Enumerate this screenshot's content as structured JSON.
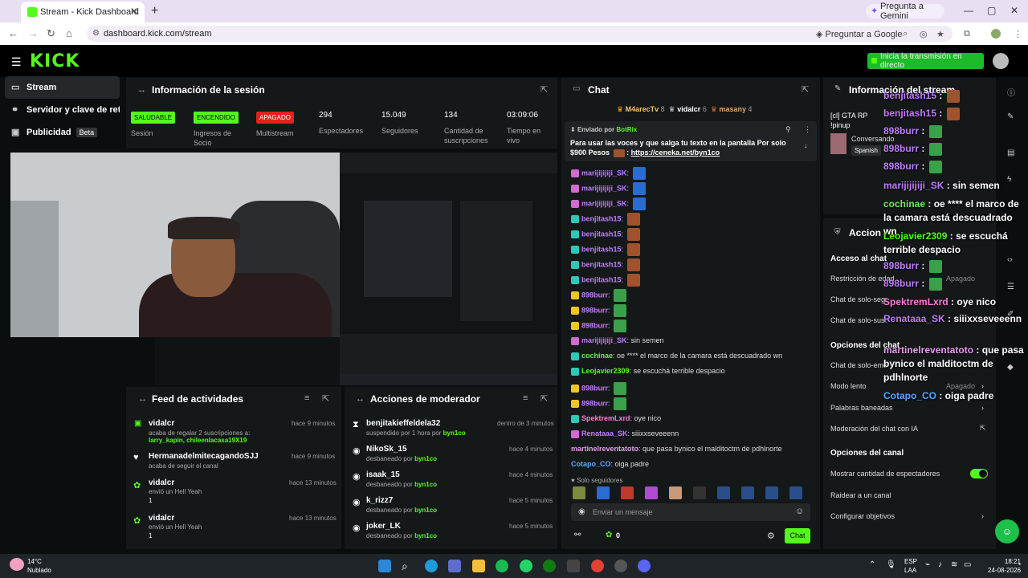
{
  "browser": {
    "tab_title": "Stream - Kick Dashboard",
    "url": "dashboard.kick.com/stream",
    "gemini_label": "Pregunta a Gemini",
    "google_label": "Preguntar a Google"
  },
  "kick": {
    "logo": "KICK",
    "go_live_label": "Inicia la transmisión en directo"
  },
  "sidebar": {
    "items": [
      {
        "label": "Stream"
      },
      {
        "label": "Servidor y clave de retran"
      },
      {
        "label": "Publicidad"
      }
    ],
    "beta": "Beta"
  },
  "session": {
    "title": "Información de la sesión",
    "stats": [
      {
        "badge": "SALUDABLE",
        "label": "Sesión",
        "color": "#53fc18"
      },
      {
        "badge": "ENCENDIDO",
        "label": "Ingresos de Socio",
        "color": "#53fc18"
      },
      {
        "badge": "APAGADO",
        "label": "Multistream",
        "color": "#e0231c"
      },
      {
        "value": "294",
        "label": "Espectadores"
      },
      {
        "value": "15.049",
        "label": "Seguidores"
      },
      {
        "value": "134",
        "label": "Cantidad de suscripciones"
      },
      {
        "value": "03:09:06",
        "label": "Tiempo en vivo"
      }
    ]
  },
  "feed": {
    "title": "Feed de actividades",
    "items": [
      {
        "name": "vidalcr",
        "time": "hace 9 minutos",
        "line1": "acaba de regalar 2 suscripciones a:",
        "line2": "larry_kapin, chileenlacasa19X19"
      },
      {
        "name": "HermanadelmitecagandoSJJ",
        "time": "hace 9 minutos",
        "line1": "acaba de seguir el canal",
        "line2": ""
      },
      {
        "name": "vidalcr",
        "time": "hace 13 minutos",
        "line1": "envió un Hell Yeah",
        "line2": "1"
      },
      {
        "name": "vidalcr",
        "time": "hace 13 minutos",
        "line1": "envió un Hell Yeah",
        "line2": "1"
      }
    ]
  },
  "modactions": {
    "title": "Acciones de moderador",
    "items": [
      {
        "name": "benjitakieffeldela32",
        "time": "dentro de 3 minutos",
        "desc": "suspendido por 1 hora por",
        "by": "byn1co"
      },
      {
        "name": "NikoSk_15",
        "time": "hace 4 minutos",
        "desc": "desbaneado por",
        "by": "byn1co"
      },
      {
        "name": "isaak_15",
        "time": "hace 4 minutos",
        "desc": "desbaneado por",
        "by": "byn1co"
      },
      {
        "name": "k_rizz7",
        "time": "hace 5 minutos",
        "desc": "desbaneado por",
        "by": "byn1co"
      },
      {
        "name": "joker_LK",
        "time": "hace 5 minutos",
        "desc": "desbaneado por",
        "by": "byn1co"
      }
    ]
  },
  "chat": {
    "title": "Chat",
    "top_gifters": [
      {
        "name": "M4arecTv",
        "count": "8"
      },
      {
        "name": "vidalcr",
        "count": "6"
      },
      {
        "name": "masany",
        "count": "4"
      }
    ],
    "pinned_by_label": "Enviado por",
    "pinned_by": "BotRix",
    "pinned_text": "Para usar las voces y que salga tu texto en la pantalla Por solo $900 Pesos",
    "pinned_link": "https://ceneka.net/byn1co",
    "messages": [
      {
        "user": "marijijijiji_SK",
        "text": "",
        "color": "#c07cff"
      },
      {
        "user": "marijijijiji_SK",
        "text": "",
        "color": "#c07cff"
      },
      {
        "user": "marijijijiji_SK",
        "text": "",
        "color": "#c07cff"
      },
      {
        "user": "benjitash15",
        "text": "",
        "color": "#c07cff"
      },
      {
        "user": "benjitash15",
        "text": "",
        "color": "#c07cff"
      },
      {
        "user": "benjitash15",
        "text": "",
        "color": "#c07cff"
      },
      {
        "user": "benjitash15",
        "text": "",
        "color": "#c07cff"
      },
      {
        "user": "benjitash15",
        "text": "",
        "color": "#c07cff"
      },
      {
        "user": "898burr",
        "text": "",
        "color": "#c07cff"
      },
      {
        "user": "898burr",
        "text": "",
        "color": "#c07cff"
      },
      {
        "user": "898burr",
        "text": "",
        "color": "#c07cff"
      },
      {
        "user": "marijijijiji_SK",
        "text": "sin semen",
        "color": "#c07cff"
      },
      {
        "user": "cochinae",
        "text": "oe **** el marco de la camara está descuadrado wn",
        "color": "#7be36a"
      },
      {
        "user": "Leojavier2309",
        "text": "se escuchá terrible despacio",
        "color": "#53fc18"
      },
      {
        "user": "898burr",
        "text": "",
        "color": "#c07cff"
      },
      {
        "user": "898burr",
        "text": "",
        "color": "#c07cff"
      },
      {
        "user": "SpektremLxrd",
        "text": "oye nico",
        "color": "#ff7ad9"
      },
      {
        "user": "Renataaa_SK",
        "text": "siiixxseveeenn",
        "color": "#c07cff"
      },
      {
        "user": "martinelreventatoto",
        "text": "que pasa bynico el malditoctm de pdhlnorte",
        "color": "#e89bf0"
      },
      {
        "user": "Cotapo_CO",
        "text": "oiga padre",
        "color": "#5aa7ff"
      }
    ],
    "followers_only": "Solo seguidores",
    "input_placeholder": "Enviar un mensaje",
    "points": "0",
    "send_label": "Chat"
  },
  "streaminfo": {
    "title": "Información del stream",
    "stream_title": "[cl] GTA RP",
    "tag": "!pinup",
    "category": "Conversando",
    "language": "Spanish"
  },
  "modoptions": {
    "title": "Acciones de moderación",
    "access_head": "Acceso al chat",
    "rows_access": [
      {
        "label": "Restricción de edad",
        "value": "Apagado"
      },
      {
        "label": "Chat de solo-seguidores",
        "value": ""
      },
      {
        "label": "Chat de solo-suscriptores",
        "value": ""
      }
    ],
    "chat_head": "Opciones del chat",
    "rows_chat": [
      {
        "label": "Chat de solo-emotes",
        "value": ""
      },
      {
        "label": "Modo lento",
        "value": "Apagado"
      },
      {
        "label": "Palabras baneadas",
        "value": ""
      },
      {
        "label": "Moderación del chat con IA",
        "value": ""
      }
    ],
    "channel_head": "Opciones del canal",
    "rows_channel": [
      {
        "label": "Mostrar cantidad de espectadores",
        "value": ""
      },
      {
        "label": "Raidear a un canal",
        "value": ""
      },
      {
        "label": "Configurar objetivos",
        "value": ""
      }
    ]
  },
  "overlay_chat": [
    {
      "user": "benjitash15",
      "text": ""
    },
    {
      "user": "benjitash15",
      "text": ""
    },
    {
      "user": "898burr",
      "text": ""
    },
    {
      "user": "898burr",
      "text": ""
    },
    {
      "user": "898burr",
      "text": ""
    },
    {
      "user": "marijijijiji_SK",
      "text": "sin semen"
    },
    {
      "user": "cochinae",
      "text": "oe **** el marco de la camara está descuadrado wn"
    },
    {
      "user": "Leojavier2309",
      "text": "se escuchá terrible despacio"
    },
    {
      "user": "898burr",
      "text": ""
    },
    {
      "user": "898burr",
      "text": ""
    },
    {
      "user": "SpektremLxrd",
      "text": "oye nico"
    },
    {
      "user": "Renataaa_SK",
      "text": "siiixxseveeenn"
    },
    {
      "user": "martinelreventatoto",
      "text": "que pasa bynico el malditoctm de pdhlnorte"
    },
    {
      "user": "Cotapo_CO",
      "text": "oiga padre"
    }
  ],
  "taskbar": {
    "temp": "14°C",
    "weather": "Nublado",
    "lang1": "ESP",
    "lang2": "LAA",
    "time": "18:21",
    "date": "24-08-2026"
  }
}
